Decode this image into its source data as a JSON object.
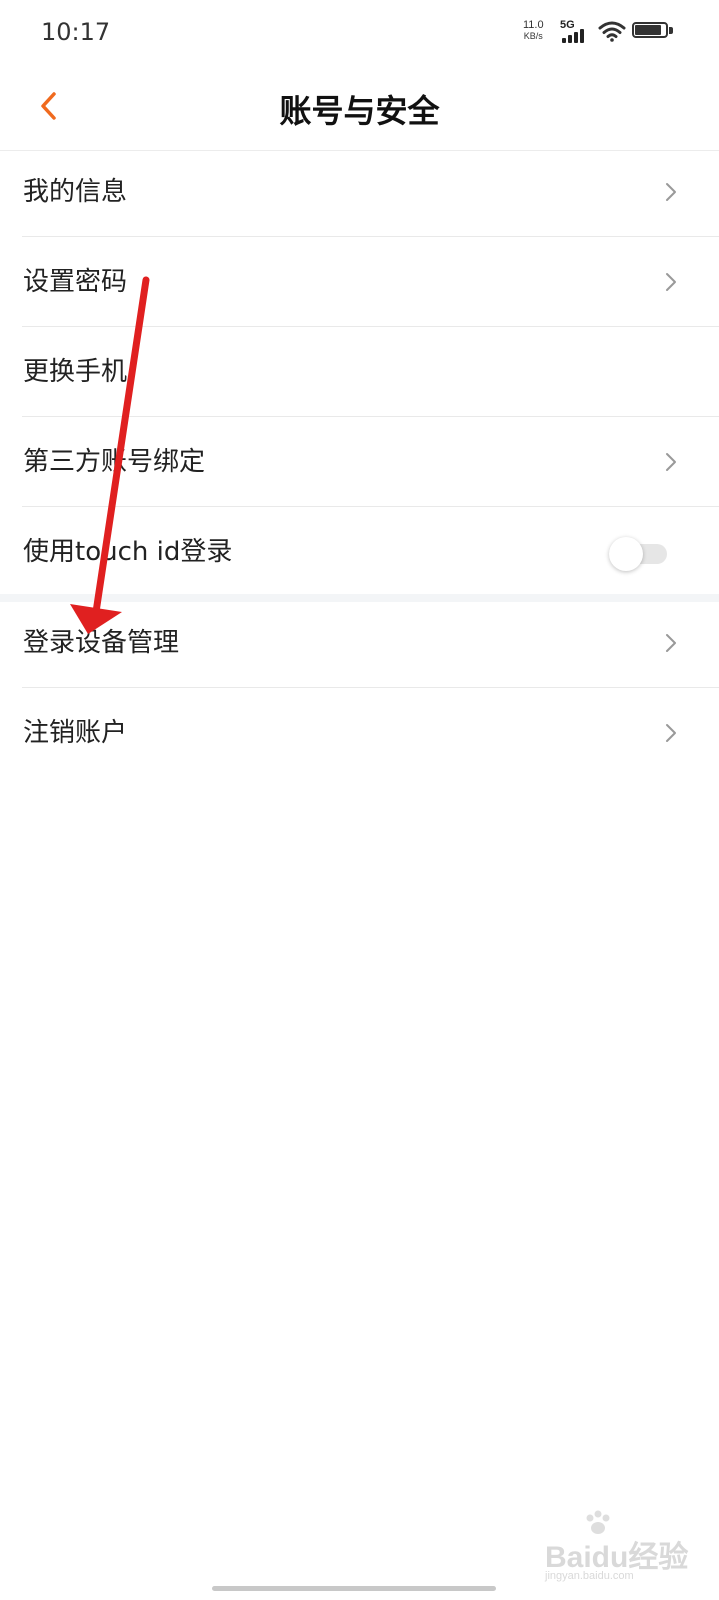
{
  "status_bar": {
    "time": "10:17",
    "net_speed_value": "11.0",
    "net_speed_unit": "KB/s",
    "network_type": "5G",
    "battery_level": 0.85
  },
  "nav": {
    "back_icon": "chevron-left-icon",
    "title": "账号与安全",
    "accent_color": "#f06a1e"
  },
  "settings": {
    "items": [
      {
        "label": "我的信息",
        "control": "chevron"
      },
      {
        "label": "设置密码",
        "control": "chevron"
      },
      {
        "label": "更换手机",
        "control": "chevron"
      },
      {
        "label": "第三方账号绑定",
        "control": "chevron"
      },
      {
        "label": "使用touch id登录",
        "control": "toggle",
        "enabled": false
      }
    ],
    "items2": [
      {
        "label": "登录设备管理",
        "control": "chevron"
      },
      {
        "label": "注销账户",
        "control": "chevron"
      }
    ]
  },
  "annotation": {
    "arrow_color": "#e02020"
  },
  "watermark": {
    "text": "Baidu经验",
    "sub": "jingyan.baidu.com"
  }
}
